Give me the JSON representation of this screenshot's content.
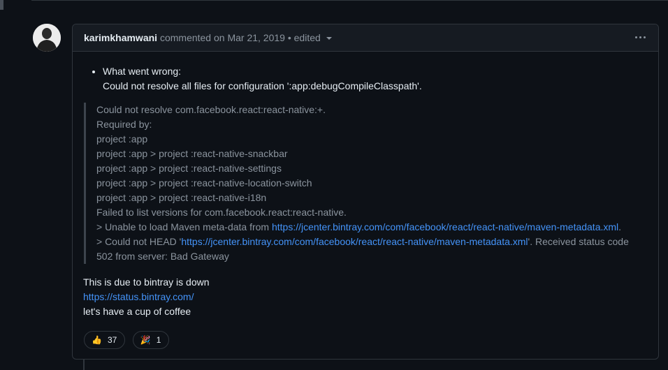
{
  "comment": {
    "author": "karimkhamwani",
    "meta": "commented on Mar 21, 2019",
    "edited": "• edited",
    "list_title": "What went wrong:",
    "list_detail": "Could not resolve all files for configuration ':app:debugCompileClasspath'.",
    "quote_lines": [
      "Could not resolve com.facebook.react:react-native:+.",
      "Required by:",
      "project :app",
      "project :app > project :react-native-snackbar",
      "project :app > project :react-native-settings",
      "project :app > project :react-native-location-switch",
      "project :app > project :react-native-i18n",
      "Failed to list versions for com.facebook.react:react-native."
    ],
    "unable_prefix": "> Unable to load Maven meta-data from ",
    "maven_url": "https://jcenter.bintray.com/com/facebook/react/react-native/maven-metadata.xml",
    "unable_suffix": ".",
    "head_prefix": "> Could not HEAD '",
    "head_suffix": "'. Received status code",
    "status_line": "502 from server: Bad Gateway",
    "followup_1": "This is due to bintray is down",
    "status_url": "https://status.bintray.com/",
    "followup_2": "let's have a cup of coffee"
  },
  "reactions": [
    {
      "icon": "thumbs-up-icon",
      "emoji": "👍",
      "count": "37"
    },
    {
      "icon": "party-popper-icon",
      "emoji": "🎉",
      "count": "1"
    }
  ]
}
